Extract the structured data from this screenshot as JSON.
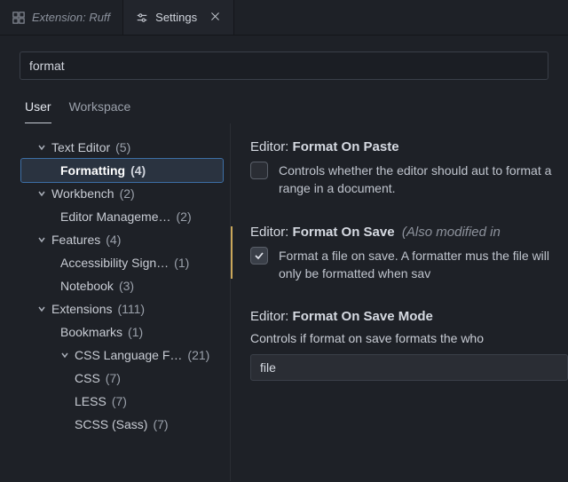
{
  "tabs": [
    {
      "label": "Extension: Ruff",
      "icon": "extensions-icon",
      "active": false
    },
    {
      "label": "Settings",
      "icon": "settings-icon",
      "active": true
    }
  ],
  "search": {
    "value": "format"
  },
  "scopeTabs": {
    "user": "User",
    "workspace": "Workspace"
  },
  "tree": {
    "textEditor": {
      "label": "Text Editor",
      "count": "(5)"
    },
    "formatting": {
      "label": "Formatting",
      "count": "(4)"
    },
    "workbench": {
      "label": "Workbench",
      "count": "(2)"
    },
    "editorMgmt": {
      "label": "Editor Manageme…",
      "count": "(2)"
    },
    "features": {
      "label": "Features",
      "count": "(4)"
    },
    "accessSign": {
      "label": "Accessibility Sign…",
      "count": "(1)"
    },
    "notebook": {
      "label": "Notebook",
      "count": "(3)"
    },
    "extensions": {
      "label": "Extensions",
      "count": "(111)"
    },
    "bookmarks": {
      "label": "Bookmarks",
      "count": "(1)"
    },
    "cssLang": {
      "label": "CSS Language F…",
      "count": "(21)"
    },
    "css": {
      "label": "CSS",
      "count": "(7)"
    },
    "less": {
      "label": "LESS",
      "count": "(7)"
    },
    "scss": {
      "label": "SCSS (Sass)",
      "count": "(7)"
    }
  },
  "settings": {
    "formatOnPaste": {
      "owner": "Editor:",
      "key": "Format On Paste",
      "desc": "Controls whether the editor should aut to format a range in a document."
    },
    "formatOnSave": {
      "owner": "Editor:",
      "key": "Format On Save",
      "note": "(Also modified in",
      "desc": "Format a file on save. A formatter mus the file will only be formatted when sav"
    },
    "formatOnSaveMode": {
      "owner": "Editor:",
      "key": "Format On Save Mode",
      "desc": "Controls if format on save formats the who",
      "value": "file"
    }
  }
}
